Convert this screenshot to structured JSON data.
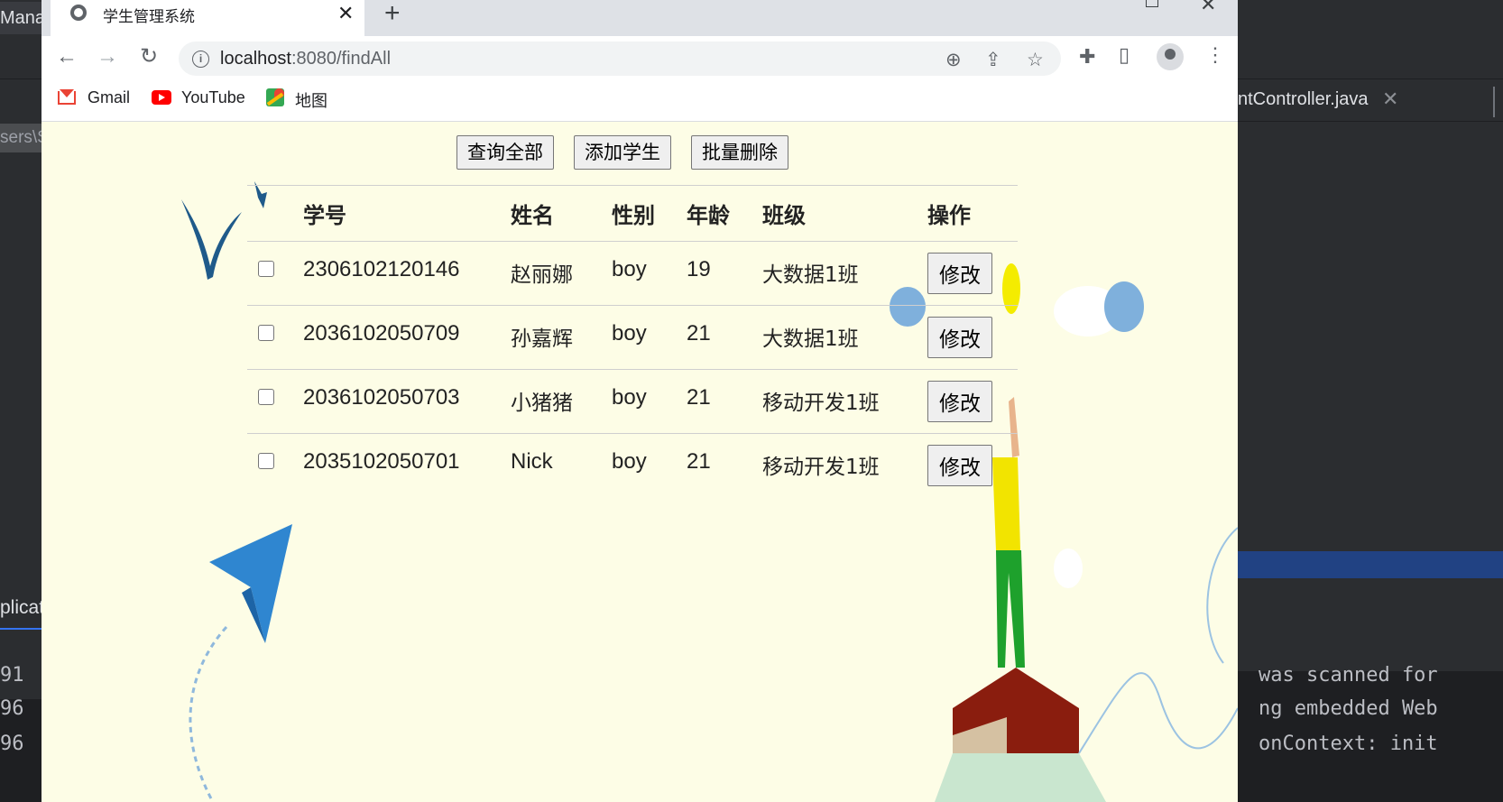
{
  "ide": {
    "left_tab_label": "Mana",
    "right_tab_label": "ntController.java",
    "left_path_fragment": "sers\\S",
    "left_run_fragment": "plicat",
    "console_right_lines": [
      "was scanned for",
      "ng embedded Web",
      "onContext: init"
    ],
    "console_left_numbers": [
      "91",
      "96",
      "96"
    ]
  },
  "browser": {
    "tab_title": "学生管理系统",
    "url_host": "localhost",
    "url_rest": ":8080/findAll",
    "bookmarks": [
      {
        "label": "Gmail",
        "icon": "gmail-icon"
      },
      {
        "label": "YouTube",
        "icon": "youtube-icon"
      },
      {
        "label": "地图",
        "icon": "maps-icon"
      }
    ]
  },
  "page": {
    "buttons": {
      "query_all": "查询全部",
      "add_student": "添加学生",
      "batch_delete": "批量删除"
    },
    "table": {
      "headers": [
        "学号",
        "姓名",
        "性别",
        "年龄",
        "班级",
        "操作"
      ],
      "rows": [
        {
          "id": "2306102120146",
          "name": "赵丽娜",
          "gender": "boy",
          "age": "19",
          "class": "大数据1班",
          "action": "修改"
        },
        {
          "id": "2036102050709",
          "name": "孙嘉辉",
          "gender": "boy",
          "age": "21",
          "class": "大数据1班",
          "action": "修改"
        },
        {
          "id": "2036102050703",
          "name": "小猪猪",
          "gender": "boy",
          "age": "21",
          "class": "移动开发1班",
          "action": "修改"
        },
        {
          "id": "2035102050701",
          "name": "Nick",
          "gender": "boy",
          "age": "21",
          "class": "移动开发1班",
          "action": "修改"
        }
      ]
    }
  }
}
